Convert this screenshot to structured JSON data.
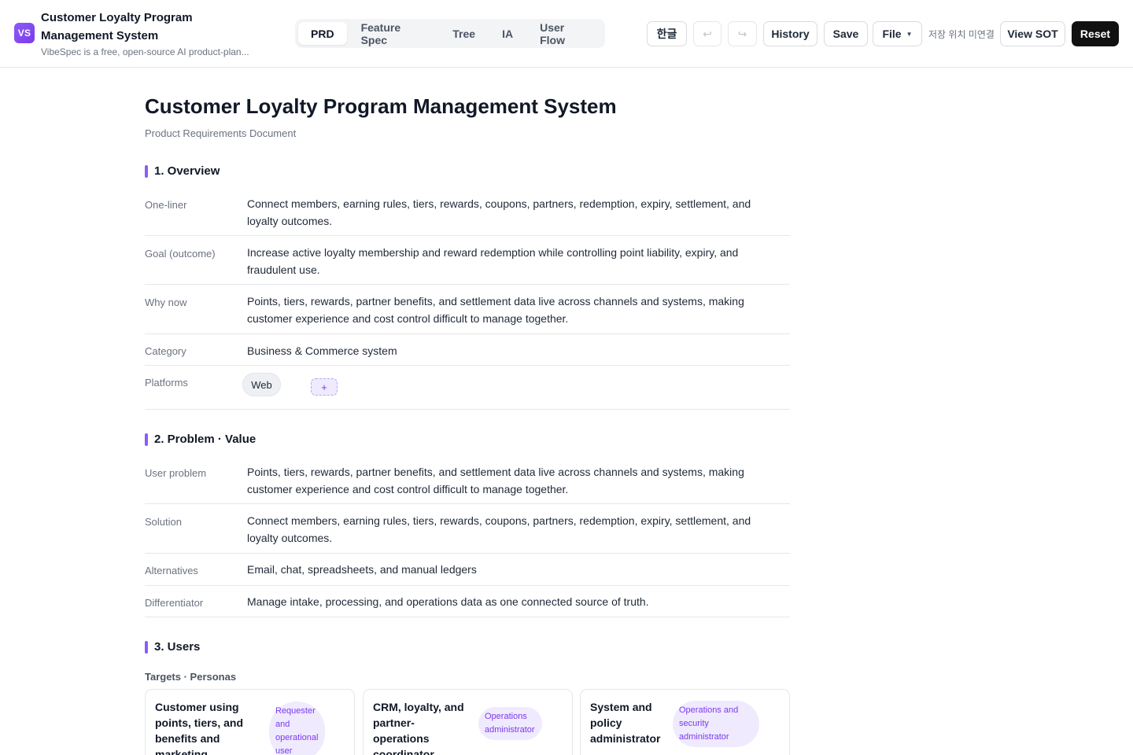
{
  "app": {
    "logo": "VS",
    "title": "Customer Loyalty Program Management System",
    "subtitle": "VibeSpec is a free, open-source AI product-plan..."
  },
  "tabs": [
    {
      "label": "PRD",
      "active": true
    },
    {
      "label": "Feature Spec",
      "active": false
    },
    {
      "label": "Tree",
      "active": false
    },
    {
      "label": "IA",
      "active": false
    },
    {
      "label": "User Flow",
      "active": false
    }
  ],
  "toolbar": {
    "language": "한글",
    "undo_icon": "↩",
    "redo_icon": "↪",
    "history": "History",
    "save": "Save",
    "file": "File",
    "save_location": "저장 위치 미연결",
    "view_sot": "View SOT",
    "reset": "Reset"
  },
  "doc": {
    "title": "Customer Loyalty Program Management System",
    "subtitle": "Product Requirements Document",
    "overview": {
      "heading": "1. Overview",
      "rows": [
        {
          "label": "One-liner",
          "value": "Connect members, earning rules, tiers, rewards, coupons, partners, redemption, expiry, settlement, and loyalty outcomes."
        },
        {
          "label": "Goal (outcome)",
          "value": "Increase active loyalty membership and reward redemption while controlling point liability, expiry, and fraudulent use."
        },
        {
          "label": "Why now",
          "value": "Points, tiers, rewards, partner benefits, and settlement data live across channels and systems, making customer experience and cost control difficult to manage together."
        },
        {
          "label": "Category",
          "value": "Business & Commerce system"
        },
        {
          "label": "Platforms",
          "value": ""
        }
      ],
      "platforms": [
        "Web"
      ],
      "add_label": "+"
    },
    "problem": {
      "heading": "2. Problem · Value",
      "rows": [
        {
          "label": "User problem",
          "value": "Points, tiers, rewards, partner benefits, and settlement data live across channels and systems, making customer experience and cost control difficult to manage together."
        },
        {
          "label": "Solution",
          "value": "Connect members, earning rules, tiers, rewards, coupons, partners, redemption, expiry, settlement, and loyalty outcomes."
        },
        {
          "label": "Alternatives",
          "value": "Email, chat, spreadsheets, and manual ledgers"
        },
        {
          "label": "Differentiator",
          "value": "Manage intake, processing, and operations data as one connected source of truth."
        }
      ]
    },
    "users": {
      "heading": "3. Users",
      "subheading": "Targets · Personas",
      "personas": [
        {
          "name": "Customer using points, tiers, and benefits and marketing practitioner",
          "role": "Requester and operational user"
        },
        {
          "name": "CRM, loyalty, and partner-operations coordinator",
          "role": "Operations administrator"
        },
        {
          "name": "System and policy administrator",
          "role": "Operations and security administrator"
        }
      ]
    }
  }
}
